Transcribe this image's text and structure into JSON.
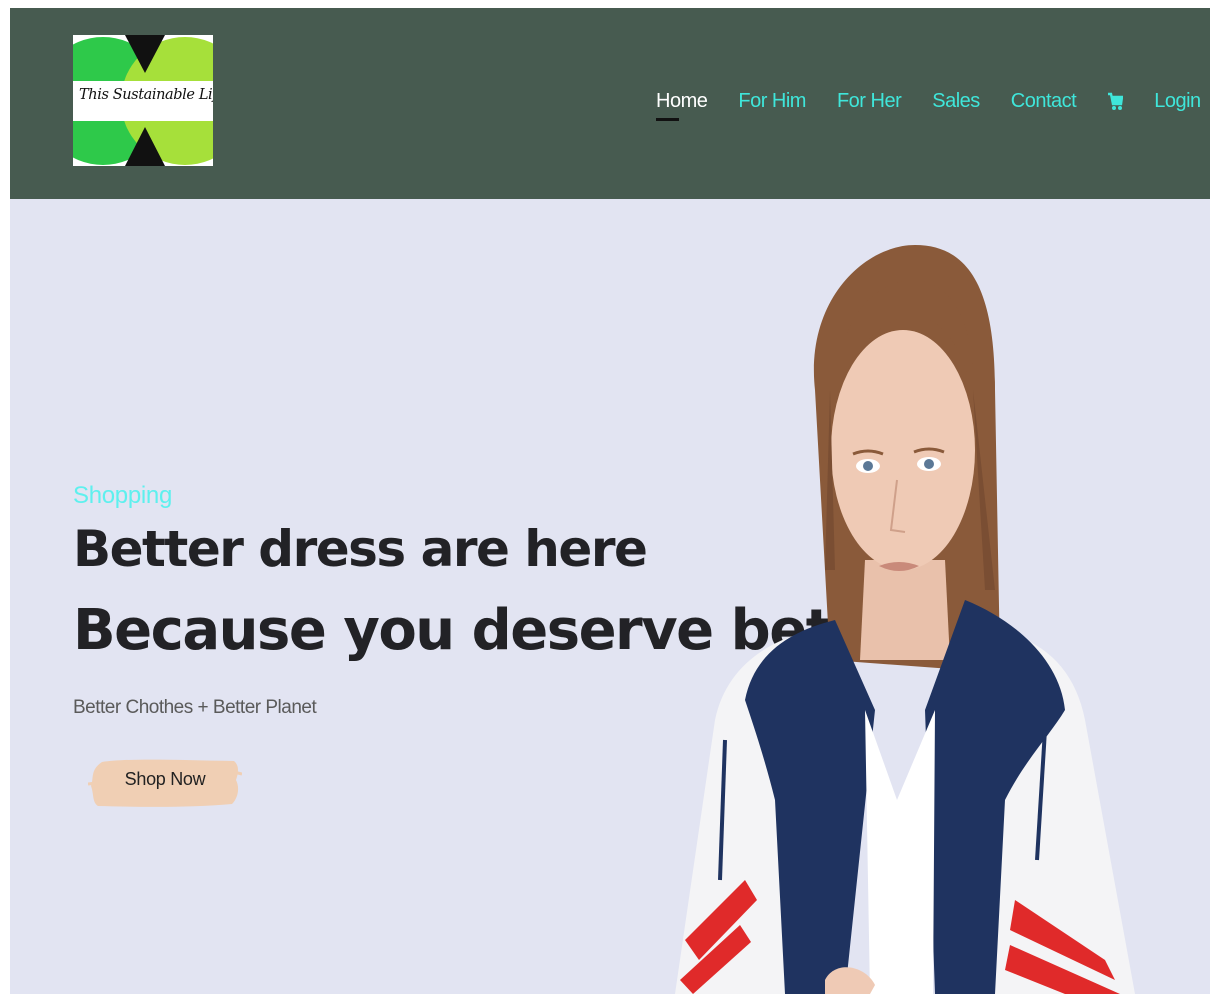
{
  "brand": {
    "logo_text": "This Sustainable Life",
    "logo_colors": {
      "left": "#2ec94a",
      "right": "#a6e03a",
      "center": "#111111"
    }
  },
  "nav": {
    "items": [
      {
        "label": "Home",
        "active": true
      },
      {
        "label": "For Him",
        "active": false
      },
      {
        "label": "For Her",
        "active": false
      },
      {
        "label": "Sales",
        "active": false
      },
      {
        "label": "Contact",
        "active": false
      }
    ],
    "cart_icon": "shopping-cart-icon",
    "login_label": "Login"
  },
  "hero": {
    "eyebrow": "Shopping",
    "headline_1": "Better dress are here",
    "headline_2": "Because you deserve better",
    "subtitle": "Better Chothes + Better Planet",
    "cta_label": "Shop Now"
  },
  "colors": {
    "navbar_bg": "#475b50",
    "page_bg": "#e2e4f2",
    "nav_link": "#3fe6da",
    "eyebrow": "#5ef0ee",
    "cta_bg": "#f0cfb4"
  }
}
